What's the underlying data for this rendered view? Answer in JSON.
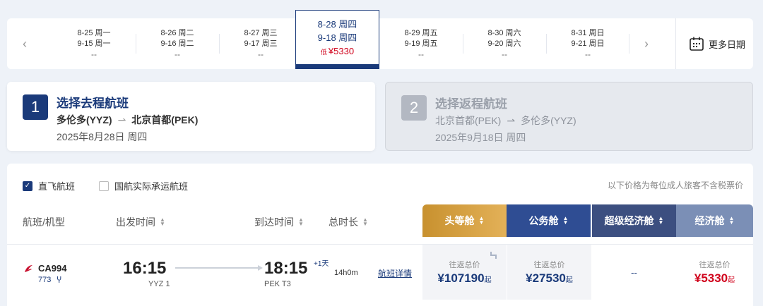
{
  "date_strip": {
    "dates": [
      {
        "line1": "8-25 周一",
        "line2": "9-15 周一",
        "price": "--"
      },
      {
        "line1": "8-26 周二",
        "line2": "9-16 周二",
        "price": "--"
      },
      {
        "line1": "8-27 周三",
        "line2": "9-17 周三",
        "price": "--"
      },
      {
        "line1": "8-28 周四",
        "line2": "9-18 周四",
        "low": "低",
        "price": "¥5330",
        "selected": true
      },
      {
        "line1": "8-29 周五",
        "line2": "9-19 周五",
        "price": "--"
      },
      {
        "line1": "8-30 周六",
        "line2": "9-20 周六",
        "price": "--"
      },
      {
        "line1": "8-31 周日",
        "line2": "9-21 周日",
        "price": "--"
      }
    ],
    "prev_icon": "chevron-left-icon",
    "next_icon": "chevron-right-icon",
    "more_dates_label": "更多日期",
    "more_dates_icon": "calendar-icon"
  },
  "steps": [
    {
      "num": "1",
      "title": "选择去程航班",
      "from": "多伦多(YYZ)",
      "to": "北京首都(PEK)",
      "date": "2025年8月28日 周四",
      "active": true
    },
    {
      "num": "2",
      "title": "选择返程航班",
      "from": "北京首都(PEK)",
      "to": "多伦多(YYZ)",
      "date": "2025年9月18日 周四",
      "active": false
    }
  ],
  "filters": [
    {
      "label": "直飞航班",
      "checked": true
    },
    {
      "label": "国航实际承运航班",
      "checked": false
    }
  ],
  "price_note": "以下价格为每位成人旅客不含税票价",
  "columns": {
    "flight": "航班/机型",
    "depart": "出发时间",
    "arrive": "到达时间",
    "duration": "总时长"
  },
  "cabins": [
    {
      "label": "头等舱"
    },
    {
      "label": "公务舱"
    },
    {
      "label": "超级经济舱"
    },
    {
      "label": "经济舱"
    }
  ],
  "flights": [
    {
      "airline_icon": "air-china-logo-icon",
      "flight_no": "CA994",
      "aircraft": "773",
      "meal_icon": "meal-icon",
      "dep_time": "16:15",
      "dep_airport": "YYZ 1",
      "arr_time": "18:15",
      "plus_day": "+1天",
      "arr_airport": "PEK T3",
      "duration": "14h0m",
      "detail_link": "航班详情",
      "fares": {
        "first": {
          "label": "往返总价",
          "price": "¥107190",
          "suffix": "起"
        },
        "business": {
          "label": "往返总价",
          "price": "¥27530",
          "suffix": "起"
        },
        "premium": {
          "value": "--"
        },
        "economy": {
          "label": "往返总价",
          "price": "¥5330",
          "suffix": "起"
        }
      }
    }
  ],
  "colors": {
    "primary": "#1a3a7a",
    "price_red": "#d0021b",
    "first_gold": "#d4a047"
  }
}
